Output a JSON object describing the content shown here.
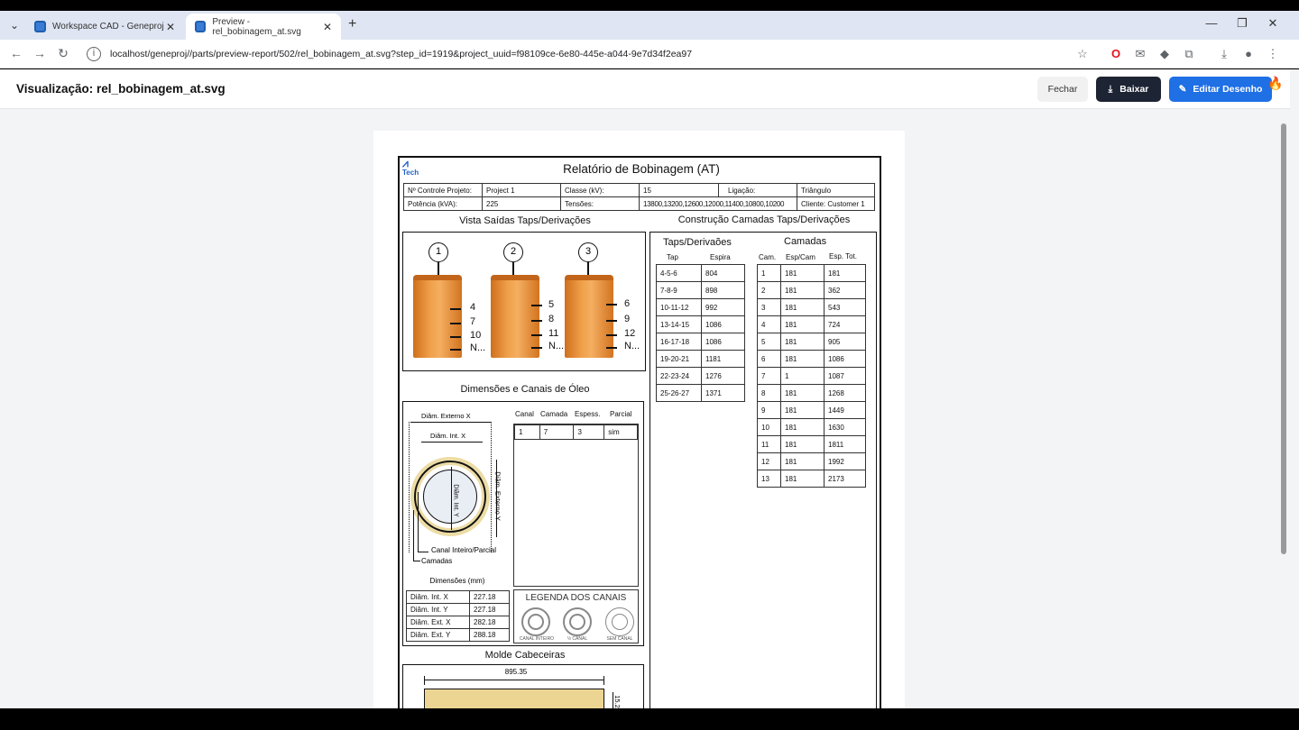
{
  "browser": {
    "tabs": [
      {
        "label": "Workspace CAD - Geneproj",
        "active": false
      },
      {
        "label": "Preview - rel_bobinagem_at.svg",
        "active": true
      }
    ],
    "url": "localhost/geneproj//parts/preview-report/502/rel_bobinagem_at.svg?step_id=1919&project_uuid=f98109ce-6e80-445e-a044-9e7d34f2ea97"
  },
  "header": {
    "title": "Visualização: rel_bobinagem_at.svg",
    "close_label": "Fechar",
    "download_label": "Baixar",
    "edit_label": "Editar Desenho"
  },
  "report": {
    "logo": "Tech",
    "title": "Relatório de Bobinagem (AT)",
    "info": {
      "row1": [
        "Nº Controle Projeto:",
        "Project 1",
        "Classe (kV):",
        "15",
        "Ligação:",
        "Triângulo"
      ],
      "row2": [
        "Potência (kVA):",
        "225",
        "Tensões:",
        "13800,13200,12600,12000,11400,10800,10200",
        "Cliente:",
        "Customer 1"
      ]
    },
    "taps_view_title": "Vista Saídas Taps/Derivações",
    "layers_title": "Construção Camadas Taps/Derivações",
    "coils": [
      {
        "num": "1",
        "taps": [
          "4",
          "7",
          "10",
          "N..."
        ]
      },
      {
        "num": "2",
        "taps": [
          "5",
          "8",
          "11",
          "N..."
        ]
      },
      {
        "num": "3",
        "taps": [
          "6",
          "9",
          "12",
          "N..."
        ]
      }
    ],
    "taps_table": {
      "title": "Taps/Derivaões",
      "headers": [
        "Tap",
        "Espira"
      ],
      "rows": [
        [
          "4-5-6",
          "804"
        ],
        [
          "7-8-9",
          "898"
        ],
        [
          "10-11-12",
          "992"
        ],
        [
          "13-14-15",
          "1086"
        ],
        [
          "16-17-18",
          "1086"
        ],
        [
          "19-20-21",
          "1181"
        ],
        [
          "22-23-24",
          "1276"
        ],
        [
          "25-26-27",
          "1371"
        ]
      ]
    },
    "layers_table": {
      "title": "Camadas",
      "headers": [
        "Cam.",
        "Esp/Cam",
        "Esp. Tot."
      ],
      "rows": [
        [
          "1",
          "181",
          "181"
        ],
        [
          "2",
          "181",
          "362"
        ],
        [
          "3",
          "181",
          "543"
        ],
        [
          "4",
          "181",
          "724"
        ],
        [
          "5",
          "181",
          "905"
        ],
        [
          "6",
          "181",
          "1086"
        ],
        [
          "7",
          "1",
          "1087"
        ],
        [
          "8",
          "181",
          "1268"
        ],
        [
          "9",
          "181",
          "1449"
        ],
        [
          "10",
          "181",
          "1630"
        ],
        [
          "11",
          "181",
          "1811"
        ],
        [
          "12",
          "181",
          "1992"
        ],
        [
          "13",
          "181",
          "2173"
        ]
      ]
    },
    "oil_title": "Dimensões e Canais de Óleo",
    "oil_labels": {
      "ext_x": "Diâm. Externo X",
      "int_x": "Diâm. Int. X",
      "int_y": "Diâm. Int. Y",
      "ext_y": "Diâm. Externo Y",
      "channel": "Canal Inteiro/Parcial",
      "layers": "Camadas"
    },
    "channels_table": {
      "headers": [
        "Canal",
        "Camada",
        "Espess.",
        "Parcial"
      ],
      "rows": [
        [
          "1",
          "7",
          "3",
          "sim"
        ]
      ]
    },
    "dims_title": "Dimensões (mm)",
    "dims": [
      [
        "Diâm. Int. X",
        "227.18"
      ],
      [
        "Diâm. Int. Y",
        "227.18"
      ],
      [
        "Diâm. Ext. X",
        "282.18"
      ],
      [
        "Diâm. Ext. Y",
        "288.18"
      ]
    ],
    "legend": {
      "title": "LEGENDA DOS CANAIS",
      "items": [
        "CANAL INTEIRO",
        "½ CANAL",
        "SEM CANAL"
      ]
    },
    "mold_title": "Molde Cabeceiras",
    "mold_width": "895.35",
    "mold_height": "15.2"
  }
}
